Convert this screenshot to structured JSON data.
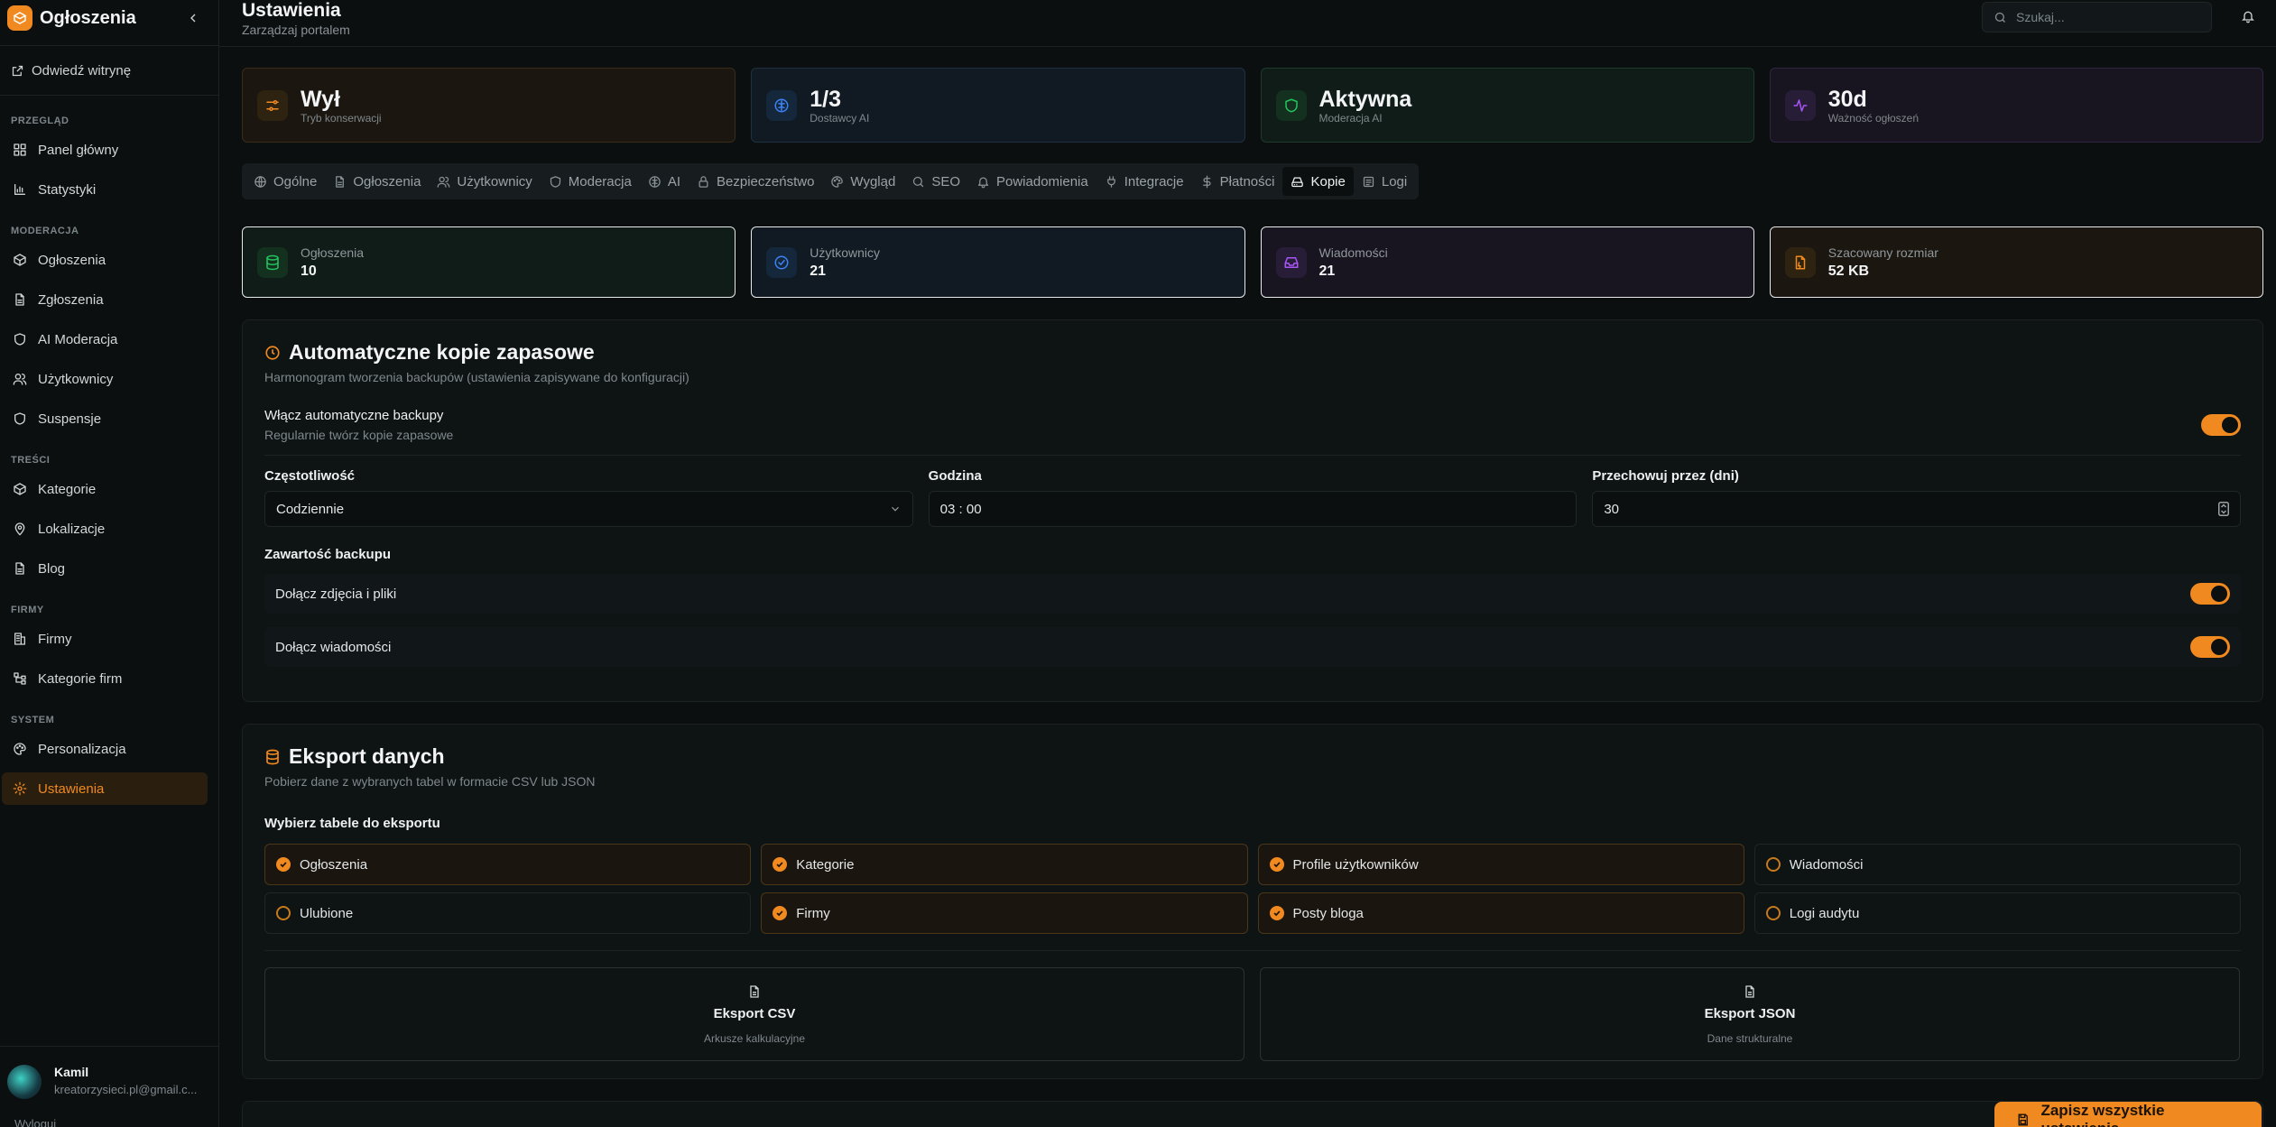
{
  "sidebar": {
    "brand": "Ogłoszenia",
    "visit": "Odwiedź witrynę",
    "sections": [
      {
        "label": "PRZEGLĄD",
        "items": [
          {
            "label": "Panel główny",
            "icon": "dashboard-icon"
          },
          {
            "label": "Statystyki",
            "icon": "chart-icon"
          }
        ]
      },
      {
        "label": "MODERACJA",
        "items": [
          {
            "label": "Ogłoszenia",
            "icon": "package-icon"
          },
          {
            "label": "Zgłoszenia",
            "icon": "document-icon"
          },
          {
            "label": "AI Moderacja",
            "icon": "shield-icon"
          },
          {
            "label": "Użytkownicy",
            "icon": "users-icon"
          },
          {
            "label": "Suspensje",
            "icon": "shield-icon"
          }
        ]
      },
      {
        "label": "TREŚCI",
        "items": [
          {
            "label": "Kategorie",
            "icon": "package-icon"
          },
          {
            "label": "Lokalizacje",
            "icon": "map-pin-icon"
          },
          {
            "label": "Blog",
            "icon": "document-icon"
          }
        ]
      },
      {
        "label": "FIRMY",
        "items": [
          {
            "label": "Firmy",
            "icon": "building-icon"
          },
          {
            "label": "Kategorie firm",
            "icon": "tree-icon"
          }
        ]
      },
      {
        "label": "SYSTEM",
        "items": [
          {
            "label": "Personalizacja",
            "icon": "palette-icon"
          },
          {
            "label": "Ustawienia",
            "icon": "gear-icon",
            "active": true
          }
        ]
      }
    ],
    "user": {
      "name": "Kamil",
      "email": "kreatorzysieci.pl@gmail.c...",
      "extra": "Wyloguj"
    }
  },
  "header": {
    "title": "Ustawienia",
    "subtitle": "Zarządzaj portalem",
    "search_placeholder": "Szukaj..."
  },
  "stats": [
    {
      "value": "Wył",
      "label": "Tryb konserwacji",
      "color": "#f0891f",
      "icon": "sliders-icon",
      "theme": "orange"
    },
    {
      "value": "1/3",
      "label": "Dostawcy AI",
      "color": "#3b82f6",
      "icon": "brain-icon",
      "theme": "blue"
    },
    {
      "value": "Aktywna",
      "label": "Moderacja AI",
      "color": "#22c55e",
      "icon": "shield-icon",
      "theme": "green"
    },
    {
      "value": "30d",
      "label": "Ważność ogłoszeń",
      "color": "#a855f7",
      "icon": "activity-icon",
      "theme": "purple"
    }
  ],
  "tabs": [
    {
      "label": "Ogólne",
      "icon": "globe-icon"
    },
    {
      "label": "Ogłoszenia",
      "icon": "document-icon"
    },
    {
      "label": "Użytkownicy",
      "icon": "users-icon"
    },
    {
      "label": "Moderacja",
      "icon": "shield-icon"
    },
    {
      "label": "AI",
      "icon": "brain-icon"
    },
    {
      "label": "Bezpieczeństwo",
      "icon": "lock-icon"
    },
    {
      "label": "Wygląd",
      "icon": "palette-icon"
    },
    {
      "label": "SEO",
      "icon": "search-icon"
    },
    {
      "label": "Powiadomienia",
      "icon": "bell-icon"
    },
    {
      "label": "Integracje",
      "icon": "plug-icon"
    },
    {
      "label": "Płatności",
      "icon": "dollar-icon"
    },
    {
      "label": "Kopie",
      "icon": "hard-drive-icon",
      "active": true
    },
    {
      "label": "Logi",
      "icon": "log-icon"
    }
  ],
  "db_stats": [
    {
      "label": "Ogłoszenia",
      "value": "10",
      "color": "#22c55e",
      "icon": "database-icon",
      "theme": "green"
    },
    {
      "label": "Użytkownicy",
      "value": "21",
      "color": "#3b82f6",
      "icon": "check-circle-icon",
      "theme": "blue"
    },
    {
      "label": "Wiadomości",
      "value": "21",
      "color": "#a855f7",
      "icon": "inbox-icon",
      "theme": "purple"
    },
    {
      "label": "Szacowany rozmiar",
      "value": "52 KB",
      "color": "#f0891f",
      "icon": "file-icon",
      "theme": "orange"
    }
  ],
  "backup": {
    "title": "Automatyczne kopie zapasowe",
    "desc": "Harmonogram tworzenia backupów (ustawienia zapisywane do konfiguracji)",
    "enable_title": "Włącz automatyczne backupy",
    "enable_sub": "Regularnie twórz kopie zapasowe",
    "enabled": true,
    "frequency_label": "Częstotliwość",
    "frequency_value": "Codziennie",
    "time_label": "Godzina",
    "time_value": "03 : 00",
    "retention_label": "Przechowuj przez (dni)",
    "retention_value": "30",
    "content_label": "Zawartość backupu",
    "include_files": "Dołącz zdjęcia i pliki",
    "include_messages": "Dołącz wiadomości"
  },
  "export": {
    "title": "Eksport danych",
    "desc": "Pobierz dane z wybranych tabel w formacie CSV lub JSON",
    "choose_label": "Wybierz tabele do eksportu",
    "tables": [
      {
        "label": "Ogłoszenia",
        "checked": true
      },
      {
        "label": "Kategorie",
        "checked": true
      },
      {
        "label": "Profile użytkowników",
        "checked": true
      },
      {
        "label": "Wiadomości",
        "checked": false
      },
      {
        "label": "Ulubione",
        "checked": false
      },
      {
        "label": "Firmy",
        "checked": true
      },
      {
        "label": "Posty bloga",
        "checked": true
      },
      {
        "label": "Logi audytu",
        "checked": false
      }
    ],
    "csv_title": "Eksport CSV",
    "csv_sub": "Arkusze kalkulacyjne",
    "json_title": "Eksport JSON",
    "json_sub": "Dane strukturalne"
  },
  "save_label": "Zapisz wszystkie ustawienia",
  "accent": "#f0891f"
}
